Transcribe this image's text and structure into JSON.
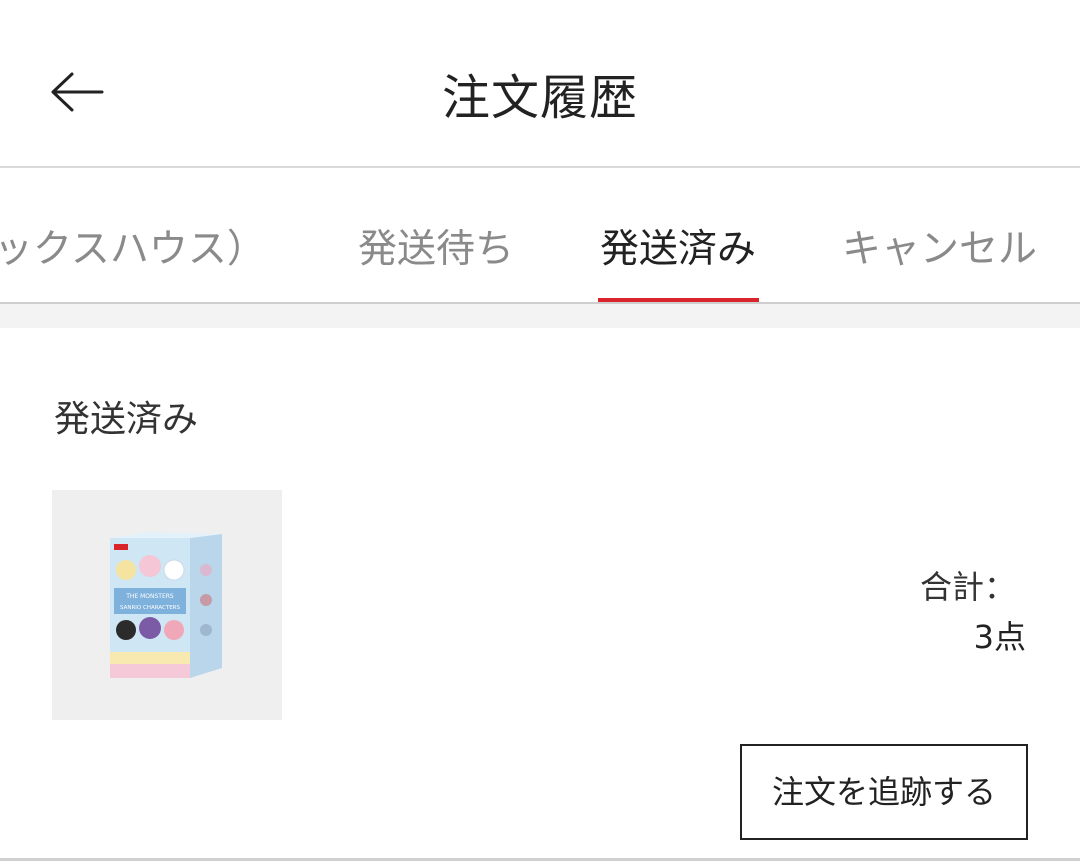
{
  "header": {
    "title": "注文履歴",
    "back_icon": "arrow-left-icon"
  },
  "tabs": [
    {
      "label": "ックスハウス）",
      "active": false
    },
    {
      "label": "発送待ち",
      "active": false
    },
    {
      "label": "発送済み",
      "active": true
    },
    {
      "label": "キャンセル",
      "active": false
    }
  ],
  "order": {
    "status": "発送済み",
    "product_image_text": [
      "THE MONSTERS",
      "SANRIO CHARACTERS"
    ],
    "total_label": "合計：",
    "total_value": "3点",
    "track_button_label": "注文を追跡する"
  },
  "colors": {
    "accent": "#d9242b",
    "inactive_tab": "#8a8a8a",
    "text": "#222222"
  }
}
